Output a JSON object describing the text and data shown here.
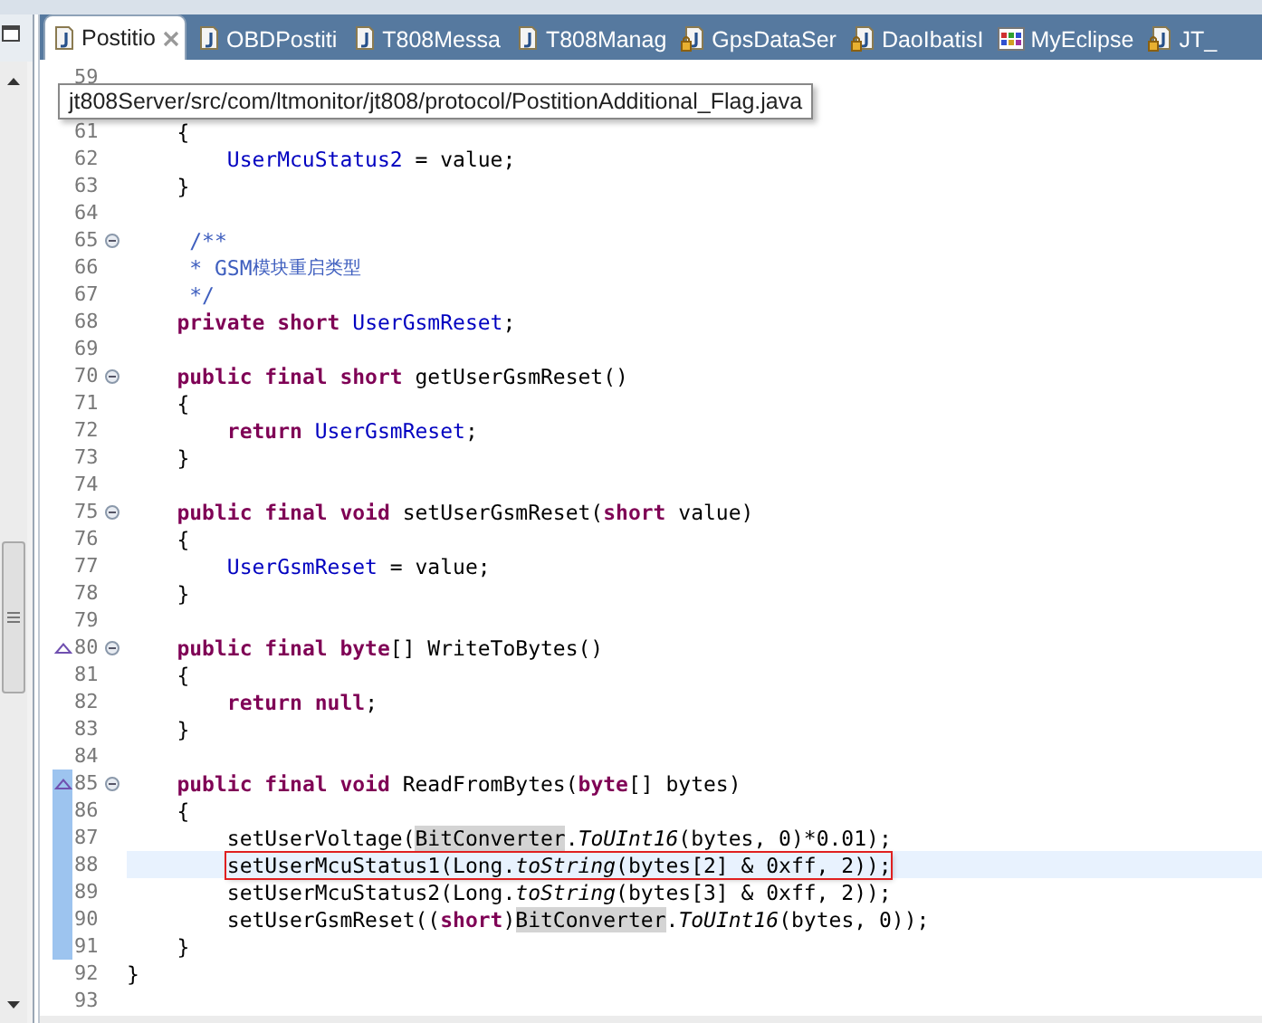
{
  "tabs": [
    {
      "label": "Postitio",
      "kind": "java",
      "selected": true
    },
    {
      "label": "OBDPostiti",
      "kind": "java",
      "selected": false
    },
    {
      "label": "T808Messa",
      "kind": "java",
      "selected": false
    },
    {
      "label": "T808Manag",
      "kind": "java",
      "selected": false
    },
    {
      "label": "GpsDataSer",
      "kind": "locked",
      "selected": false
    },
    {
      "label": "DaoIbatisI",
      "kind": "locked",
      "selected": false
    },
    {
      "label": "MyEclipse",
      "kind": "grid",
      "selected": false
    },
    {
      "label": "JT_",
      "kind": "locked",
      "selected": false
    }
  ],
  "tooltip": "jt808Server/src/com/ltmonitor/jt808/protocol/PostitionAdditional_Flag.java",
  "lines": [
    {
      "number": "59",
      "fold": false,
      "override": false,
      "in_range": false,
      "current": false,
      "boxed": false
    },
    {
      "number": "61",
      "segments": [
        {
          "text": "    {",
          "kind": "txt"
        }
      ],
      "fold": false,
      "override": false,
      "in_range": false,
      "current": false,
      "boxed": false
    },
    {
      "number": "62",
      "segments": [
        {
          "text": "        UserMcuStatus2",
          "kind": "fld"
        },
        {
          "text": " = value;",
          "kind": "txt"
        }
      ],
      "fold": false,
      "override": false,
      "in_range": false,
      "current": false,
      "boxed": false
    },
    {
      "number": "63",
      "segments": [
        {
          "text": "    }",
          "kind": "txt"
        }
      ],
      "fold": false,
      "override": false,
      "in_range": false,
      "current": false,
      "boxed": false
    },
    {
      "number": "64",
      "fold": false,
      "override": false,
      "in_range": false,
      "current": false,
      "boxed": false
    },
    {
      "number": "65",
      "segments": [
        {
          "text": "     /**",
          "kind": "cmt"
        }
      ],
      "fold": true,
      "override": false,
      "in_range": false,
      "current": false,
      "boxed": false
    },
    {
      "number": "66",
      "segments": [
        {
          "text": "     * GSM",
          "kind": "cmt"
        },
        {
          "text": "模块重启类型",
          "kind": "cjk"
        }
      ],
      "fold": false,
      "override": false,
      "in_range": false,
      "current": false,
      "boxed": false
    },
    {
      "number": "67",
      "segments": [
        {
          "text": "     */",
          "kind": "cmt"
        }
      ],
      "fold": false,
      "override": false,
      "in_range": false,
      "current": false,
      "boxed": false
    },
    {
      "number": "68",
      "segments": [
        {
          "text": "    private short",
          "kind": "kw"
        },
        {
          "text": " UserGsmReset",
          "kind": "fld"
        },
        {
          "text": ";",
          "kind": "txt"
        }
      ],
      "fold": false,
      "override": false,
      "in_range": false,
      "current": false,
      "boxed": false
    },
    {
      "number": "69",
      "fold": false,
      "override": false,
      "in_range": false,
      "current": false,
      "boxed": false
    },
    {
      "number": "70",
      "segments": [
        {
          "text": "    public final short",
          "kind": "kw"
        },
        {
          "text": " getUserGsmReset()",
          "kind": "txt"
        }
      ],
      "fold": true,
      "override": false,
      "in_range": false,
      "current": false,
      "boxed": false
    },
    {
      "number": "71",
      "segments": [
        {
          "text": "    {",
          "kind": "txt"
        }
      ],
      "fold": false,
      "override": false,
      "in_range": false,
      "current": false,
      "boxed": false
    },
    {
      "number": "72",
      "segments": [
        {
          "text": "        return",
          "kind": "kw"
        },
        {
          "text": " UserGsmReset",
          "kind": "fld"
        },
        {
          "text": ";",
          "kind": "txt"
        }
      ],
      "fold": false,
      "override": false,
      "in_range": false,
      "current": false,
      "boxed": false
    },
    {
      "number": "73",
      "segments": [
        {
          "text": "    }",
          "kind": "txt"
        }
      ],
      "fold": false,
      "override": false,
      "in_range": false,
      "current": false,
      "boxed": false
    },
    {
      "number": "74",
      "fold": false,
      "override": false,
      "in_range": false,
      "current": false,
      "boxed": false
    },
    {
      "number": "75",
      "segments": [
        {
          "text": "    public final void",
          "kind": "kw"
        },
        {
          "text": " setUserGsmReset(",
          "kind": "txt"
        },
        {
          "text": "short",
          "kind": "kw"
        },
        {
          "text": " value)",
          "kind": "txt"
        }
      ],
      "fold": true,
      "override": false,
      "in_range": false,
      "current": false,
      "boxed": false
    },
    {
      "number": "76",
      "segments": [
        {
          "text": "    {",
          "kind": "txt"
        }
      ],
      "fold": false,
      "override": false,
      "in_range": false,
      "current": false,
      "boxed": false
    },
    {
      "number": "77",
      "segments": [
        {
          "text": "        UserGsmReset",
          "kind": "fld"
        },
        {
          "text": " = value;",
          "kind": "txt"
        }
      ],
      "fold": false,
      "override": false,
      "in_range": false,
      "current": false,
      "boxed": false
    },
    {
      "number": "78",
      "segments": [
        {
          "text": "    }",
          "kind": "txt"
        }
      ],
      "fold": false,
      "override": false,
      "in_range": false,
      "current": false,
      "boxed": false
    },
    {
      "number": "79",
      "fold": false,
      "override": false,
      "in_range": false,
      "current": false,
      "boxed": false
    },
    {
      "number": "80",
      "segments": [
        {
          "text": "    public final byte",
          "kind": "kw"
        },
        {
          "text": "[] WriteToBytes()",
          "kind": "txt"
        }
      ],
      "fold": true,
      "override": true,
      "in_range": false,
      "current": false,
      "boxed": false
    },
    {
      "number": "81",
      "segments": [
        {
          "text": "    {",
          "kind": "txt"
        }
      ],
      "fold": false,
      "override": false,
      "in_range": false,
      "current": false,
      "boxed": false
    },
    {
      "number": "82",
      "segments": [
        {
          "text": "        return null",
          "kind": "kw"
        },
        {
          "text": ";",
          "kind": "txt"
        }
      ],
      "fold": false,
      "override": false,
      "in_range": false,
      "current": false,
      "boxed": false
    },
    {
      "number": "83",
      "segments": [
        {
          "text": "    }",
          "kind": "txt"
        }
      ],
      "fold": false,
      "override": false,
      "in_range": false,
      "current": false,
      "boxed": false
    },
    {
      "number": "84",
      "fold": false,
      "override": false,
      "in_range": false,
      "current": false,
      "boxed": false
    },
    {
      "number": "85",
      "segments": [
        {
          "text": "    public final void",
          "kind": "kw"
        },
        {
          "text": " ReadFromBytes(",
          "kind": "txt"
        },
        {
          "text": "byte",
          "kind": "kw"
        },
        {
          "text": "[] bytes)",
          "kind": "txt"
        }
      ],
      "fold": true,
      "override": true,
      "in_range": true,
      "current": false,
      "boxed": false
    },
    {
      "number": "86",
      "segments": [
        {
          "text": "    {",
          "kind": "txt"
        }
      ],
      "fold": false,
      "override": false,
      "in_range": true,
      "current": false,
      "boxed": false
    },
    {
      "number": "87",
      "segments": [
        {
          "text": "        setUserVoltage(",
          "kind": "txt"
        },
        {
          "text": "BitConverter",
          "kind": "occ"
        },
        {
          "text": ".",
          "kind": "txt"
        },
        {
          "text": "ToUInt16",
          "kind": "it"
        },
        {
          "text": "(bytes, 0)*0.01);",
          "kind": "txt"
        }
      ],
      "fold": false,
      "override": false,
      "in_range": true,
      "current": false,
      "boxed": false
    },
    {
      "number": "88",
      "segments": [
        {
          "text": "        setUserMcuStatus1(Long.",
          "kind": "txt"
        },
        {
          "text": "toString",
          "kind": "it"
        },
        {
          "text": "(bytes[2] & 0xff, 2));",
          "kind": "txt"
        }
      ],
      "fold": false,
      "override": false,
      "in_range": true,
      "current": true,
      "boxed": true
    },
    {
      "number": "89",
      "segments": [
        {
          "text": "        setUserMcuStatus2(Long.",
          "kind": "txt"
        },
        {
          "text": "toString",
          "kind": "it"
        },
        {
          "text": "(bytes[3] & 0xff, 2));",
          "kind": "txt"
        }
      ],
      "fold": false,
      "override": false,
      "in_range": true,
      "current": false,
      "boxed": false
    },
    {
      "number": "90",
      "segments": [
        {
          "text": "        setUserGsmReset((",
          "kind": "txt"
        },
        {
          "text": "short",
          "kind": "kw"
        },
        {
          "text": ")",
          "kind": "txt"
        },
        {
          "text": "BitConverter",
          "kind": "occ"
        },
        {
          "text": ".",
          "kind": "txt"
        },
        {
          "text": "ToUInt16",
          "kind": "it"
        },
        {
          "text": "(bytes, 0));",
          "kind": "txt"
        }
      ],
      "fold": false,
      "override": false,
      "in_range": true,
      "current": false,
      "boxed": false
    },
    {
      "number": "91",
      "segments": [
        {
          "text": "    }",
          "kind": "txt"
        }
      ],
      "fold": false,
      "override": false,
      "in_range": true,
      "current": false,
      "boxed": false
    },
    {
      "number": "92",
      "segments": [
        {
          "text": "}",
          "kind": "txt"
        }
      ],
      "fold": false,
      "override": false,
      "in_range": false,
      "current": false,
      "boxed": false
    },
    {
      "number": "93",
      "fold": false,
      "override": false,
      "in_range": false,
      "current": false,
      "boxed": false
    }
  ]
}
